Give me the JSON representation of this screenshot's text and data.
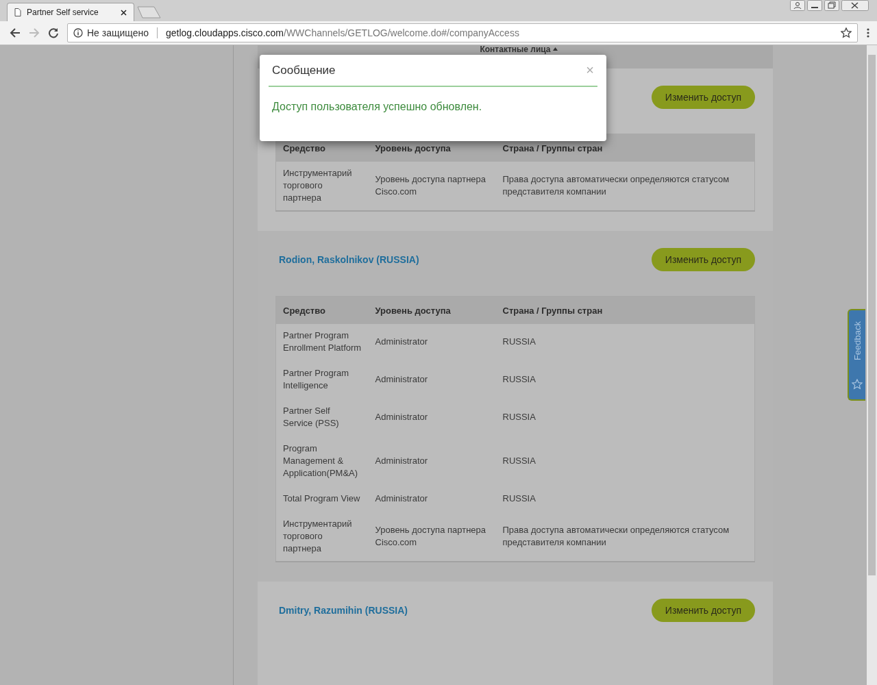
{
  "browser": {
    "tab_title": "Partner Self service",
    "security": "Не защищено",
    "url_host": "getlog.cloudapps.cisco.com",
    "url_path": "/WWChannels/GETLOG/welcome.do#/companyAccess"
  },
  "page": {
    "header_column": "Контактные лица",
    "sections": [
      {
        "button": "Изменить доступ",
        "columns": [
          "Средство",
          "Уровень доступа",
          "Страна / Группы стран"
        ],
        "rows": [
          {
            "cells": [
              "Инструментарий торгового партнера",
              "Уровень доступа партнера Cisco.com",
              "Права доступа автоматически определяются статусом представителя компании"
            ]
          }
        ]
      },
      {
        "name": "Rodion, Raskolnikov (RUSSIA)",
        "button": "Изменить доступ",
        "columns": [
          "Средство",
          "Уровень доступа",
          "Страна / Группы стран"
        ],
        "rows": [
          {
            "cells": [
              "Partner Program Enrollment Platform",
              "Administrator",
              "RUSSIA"
            ]
          },
          {
            "cells": [
              "Partner Program Intelligence",
              "Administrator",
              "RUSSIA"
            ]
          },
          {
            "cells": [
              "Partner Self Service (PSS)",
              "Administrator",
              "RUSSIA"
            ]
          },
          {
            "cells": [
              "Program Management & Application(PM&A)",
              "Administrator",
              "RUSSIA"
            ]
          },
          {
            "cells": [
              "Total Program View",
              "Administrator",
              "RUSSIA"
            ]
          },
          {
            "cells": [
              "Инструментарий торгового партнера",
              "Уровень доступа партнера Cisco.com",
              "Права доступа автоматически определяются статусом представителя компании"
            ]
          }
        ]
      },
      {
        "name": "Dmitry, Razumihin (RUSSIA)",
        "button": "Изменить доступ"
      }
    ],
    "feedback": "Feedback"
  },
  "modal": {
    "title": "Сообщение",
    "close": "×",
    "message": "Доступ пользователя успешно обновлен."
  }
}
